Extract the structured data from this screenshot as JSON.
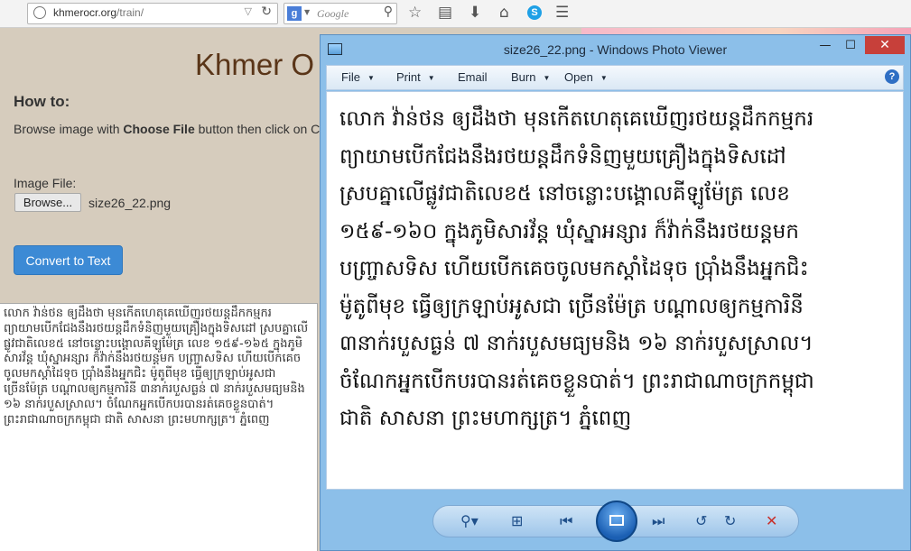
{
  "browser": {
    "url_domain": "khmerocr.org",
    "url_path": "/train/",
    "search_placeholder": "Google",
    "search_engine_letter": "g",
    "skype_letter": "S"
  },
  "page": {
    "title": "Khmer O",
    "howto_heading": "How to:",
    "howto_prefix": "Browse image with ",
    "howto_bold": "Choose File",
    "howto_suffix": " button then click on C",
    "image_file_label": "Image File:",
    "browse_button": "Browse...",
    "file_name": "size26_22.png",
    "convert_button": "Convert to Text",
    "output_text": "លោក វ៉ាន់ថន ឲ្យដឹងថា មុនកើតហេតុគេឃើញរថយន្តដឹកកម្មករ ព្យាយាមបើកជែងនឹងរថយន្តដឹកទំនិញមួយគ្រឿងក្នុងទិសដៅ ស្របគ្នាលើផ្លូវជាតិលេខ៥ នៅចន្លោះបង្គោលគីឡូម៉ែត្រ លេខ ១៥៩-១៦៥ ក្នុងភូមិសារវ័ន្ត ឃុំស្នាអន្សារ ក៏វ៉ាក់នឹងរថយន្តមក បញ្ច្រាសទិស ហើយបើកគេចចូលមកស្តាំដៃទុច ប្រ៉ាំងនឹងអ្នកជិះ ម៉ូតូពីមុខ ធ្វើឲ្យក្រឡាប់អូសជា ច្រើនម៉ែត្រ បណ្តាលឲ្យកម្មការិនី ៣នាក់របួសធ្ងន់ ៧ នាក់របួសមធ្យមនិង ១៦ នាក់របួសស្រាល។ ចំណែកអ្នកបើកបរបានរត់គេចខ្លួនបាត់។ ព្រះរាជាណាចក្រកម្ពុជា ជាតិ សាសនា ព្រះមហាក្សត្រ។ ភ្នំពេញ"
  },
  "viewer": {
    "window_title": "size26_22.png - Windows Photo Viewer",
    "menu": [
      "File",
      "Print",
      "Email",
      "Burn",
      "Open"
    ],
    "help_label": "?",
    "image_text": "លោក វ៉ាន់ថន ឲ្យដឹងថា មុនកើតហេតុគេឃើញរថយន្តដឹកកម្មករ\nព្យាយាមបើកជែងនឹងរថយន្តដឹកទំនិញមួយគ្រឿងក្នុងទិសដៅ\nស្របគ្នាលើផ្លូវជាតិលេខ៥ នៅចន្លោះបង្គោលគីឡូម៉ែត្រ លេខ\n១៥៩-១៦០ ក្នុងភូមិសារវ័ន្ត ឃុំស្នាអន្សារ ក៏វ៉ាក់នឹងរថយន្តមក\nបញ្ច្រាសទិស ហើយបើកគេចចូលមកស្តាំដៃទុច ប្រ៉ាំងនឹងអ្នកជិះ\nម៉ូតូពីមុខ ធ្វើឲ្យក្រឡាប់អូសជា ច្រើនម៉ែត្រ បណ្តាលឲ្យកម្មការិនី\n៣នាក់របួសធ្ងន់ ៧ នាក់របួសមធ្យមនិង ១៦ នាក់របួសស្រាល។\nចំណែកអ្នកបើកបរបានរត់គេចខ្លួនបាត់។ ព្រះរាជាណាចក្រកម្ពុជា\nជាតិ សាសនា ព្រះមហាក្សត្រ។ ភ្នំពេញ"
  },
  "colors": {
    "page_bg": "#d6ccbd",
    "title_brown": "#5a3518",
    "button_blue": "#3c8ad5",
    "viewer_frame": "#8cbfe9",
    "close_red": "#c7403a"
  }
}
